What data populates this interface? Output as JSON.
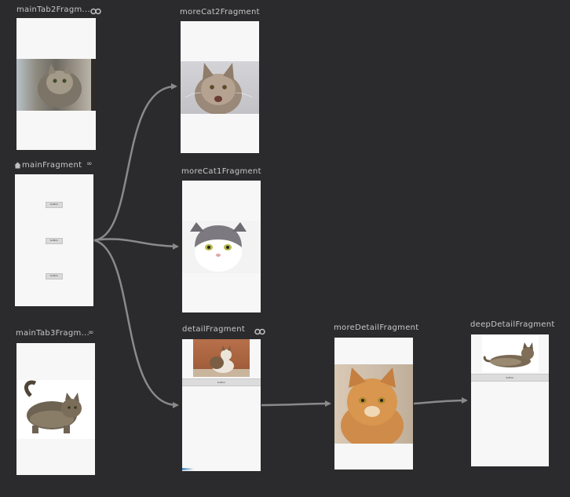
{
  "destinations": {
    "mainTab2": {
      "label": "mainTab2Fragm...",
      "icon": "link-icon"
    },
    "main": {
      "label": "mainFragment",
      "start_icon": "home-icon",
      "extra_icon": "nested-graph-icon",
      "buttons": [
        "button",
        "button",
        "button"
      ]
    },
    "mainTab3": {
      "label": "mainTab3Fragm...",
      "extra_icon": "nested-graph-icon"
    },
    "moreCat2": {
      "label": "moreCat2Fragment"
    },
    "moreCat1": {
      "label": "moreCat1Fragment"
    },
    "detail": {
      "label": "detailFragment",
      "icon": "link-icon",
      "button": "button"
    },
    "moreDetail": {
      "label": "moreDetailFragment"
    },
    "deepDetail": {
      "label": "deepDetailFragment",
      "button": "button"
    }
  },
  "actions": [
    {
      "from": "mainFragment",
      "to": "moreCat2Fragment"
    },
    {
      "from": "mainFragment",
      "to": "moreCat1Fragment"
    },
    {
      "from": "mainFragment",
      "to": "detailFragment"
    },
    {
      "from": "detailFragment",
      "to": "moreDetailFragment"
    },
    {
      "from": "moreDetailFragment",
      "to": "deepDetailFragment"
    }
  ],
  "colors": {
    "canvas": "#2b2b2d",
    "frame": "#f7f7f7",
    "arrow": "#8a8a8a",
    "label": "#c8c8c8"
  }
}
